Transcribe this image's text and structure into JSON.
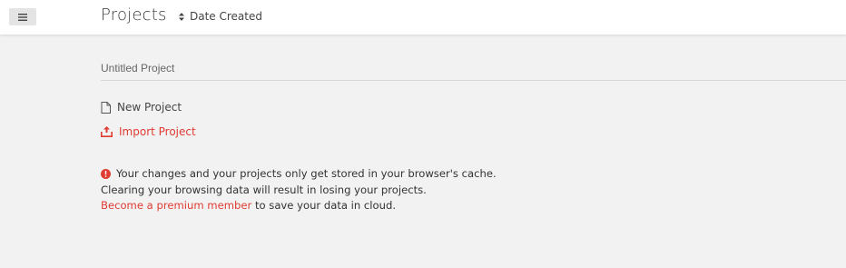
{
  "header": {
    "menu_icon": "hamburger-icon",
    "title": "Projects",
    "sort_icon": "sort-arrows-icon",
    "sort_label": "Date Created"
  },
  "projects": [
    {
      "name": "Untitled Project"
    }
  ],
  "actions": {
    "new_project": {
      "icon": "document-icon",
      "label": "New Project"
    },
    "import_project": {
      "icon": "upload-tray-icon",
      "label": "Import Project"
    }
  },
  "notice": {
    "icon": "alert-circle-icon",
    "line1": "Your changes and your projects only get stored in your browser's cache.",
    "line2": "Clearing your browsing data will result in losing your projects.",
    "premium_link": "Become a premium member",
    "line3_rest": " to save your data in cloud."
  },
  "colors": {
    "accent": "#e03c32",
    "background": "#f2f2f2",
    "header_bg": "#ffffff"
  }
}
